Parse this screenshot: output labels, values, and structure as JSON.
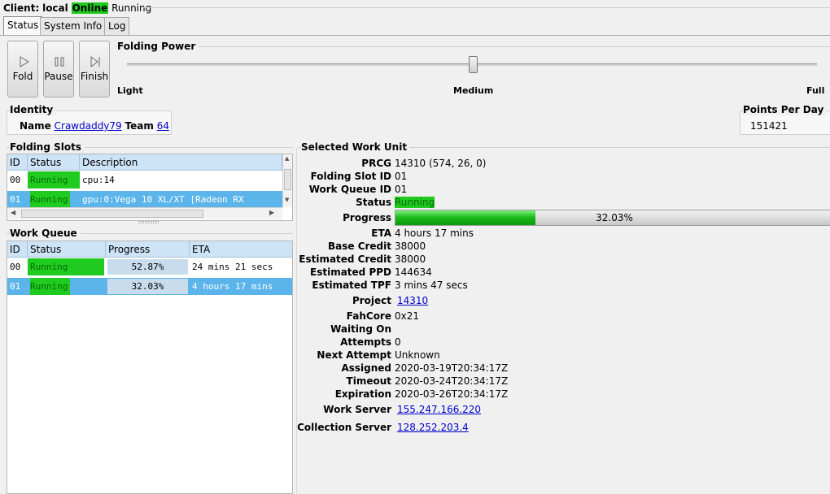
{
  "client": {
    "label": "Client:",
    "name": "local",
    "online": "Online",
    "state": "Running"
  },
  "tabs": [
    {
      "label": "Status",
      "active": true
    },
    {
      "label": "System Info",
      "active": false
    },
    {
      "label": "Log",
      "active": false
    }
  ],
  "controls": {
    "fold": "Fold",
    "pause": "Pause",
    "finish": "Finish"
  },
  "folding_power": {
    "title": "Folding Power",
    "light": "Light",
    "medium": "Medium",
    "full": "Full",
    "level": 0.5
  },
  "identity": {
    "title": "Identity",
    "name_label": "Name",
    "name": "Crawdaddy79",
    "team_label": "Team",
    "team": "64"
  },
  "ppd": {
    "title": "Points Per Day",
    "value": "151421"
  },
  "folding_slots": {
    "title": "Folding Slots",
    "columns": [
      "ID",
      "Status",
      "Description"
    ],
    "rows": [
      {
        "id": "00",
        "status": "Running",
        "description": "cpu:14"
      },
      {
        "id": "01",
        "status": "Running",
        "description": "gpu:0:Vega 10 XL/XT [Radeon RX"
      }
    ]
  },
  "work_queue": {
    "title": "Work Queue",
    "columns": [
      "ID",
      "Status",
      "Progress",
      "ETA"
    ],
    "rows": [
      {
        "id": "00",
        "status": "Running",
        "progress": "52.87%",
        "eta": "24 mins 21 secs"
      },
      {
        "id": "01",
        "status": "Running",
        "progress": "32.03%",
        "eta": "4 hours 17 mins"
      }
    ]
  },
  "selected_wu": {
    "title": "Selected Work Unit",
    "fields": {
      "prcg": {
        "label": "PRCG",
        "value": "14310 (574, 26, 0)"
      },
      "slot": {
        "label": "Folding Slot ID",
        "value": "01"
      },
      "queue": {
        "label": "Work Queue ID",
        "value": "01"
      },
      "status": {
        "label": "Status",
        "value": "Running"
      },
      "progress": {
        "label": "Progress",
        "value": "32.03%",
        "fraction": 0.3203
      },
      "eta": {
        "label": "ETA",
        "value": "4 hours 17 mins"
      },
      "base_credit": {
        "label": "Base Credit",
        "value": "38000"
      },
      "est_credit": {
        "label": "Estimated Credit",
        "value": "38000"
      },
      "est_ppd": {
        "label": "Estimated PPD",
        "value": "144634"
      },
      "est_tpf": {
        "label": "Estimated TPF",
        "value": "3 mins 47 secs"
      },
      "project": {
        "label": "Project",
        "value": "14310"
      },
      "fahcore": {
        "label": "FahCore",
        "value": "0x21"
      },
      "waiting_on": {
        "label": "Waiting On",
        "value": ""
      },
      "attempts": {
        "label": "Attempts",
        "value": "0"
      },
      "next_attempt": {
        "label": "Next Attempt",
        "value": "Unknown"
      },
      "assigned": {
        "label": "Assigned",
        "value": "2020-03-19T20:34:17Z"
      },
      "timeout": {
        "label": "Timeout",
        "value": "2020-03-24T20:34:17Z"
      },
      "expiration": {
        "label": "Expiration",
        "value": "2020-03-26T20:34:17Z"
      },
      "work_server": {
        "label": "Work Server",
        "value": "155.247.166.220"
      },
      "collection_server": {
        "label": "Collection Server",
        "value": "128.252.203.4"
      }
    }
  },
  "colors": {
    "running_green": "#1ecb1e",
    "selected_row": "#5bb5ea",
    "header_blue": "#cde3f6",
    "link": "#0000cc"
  }
}
